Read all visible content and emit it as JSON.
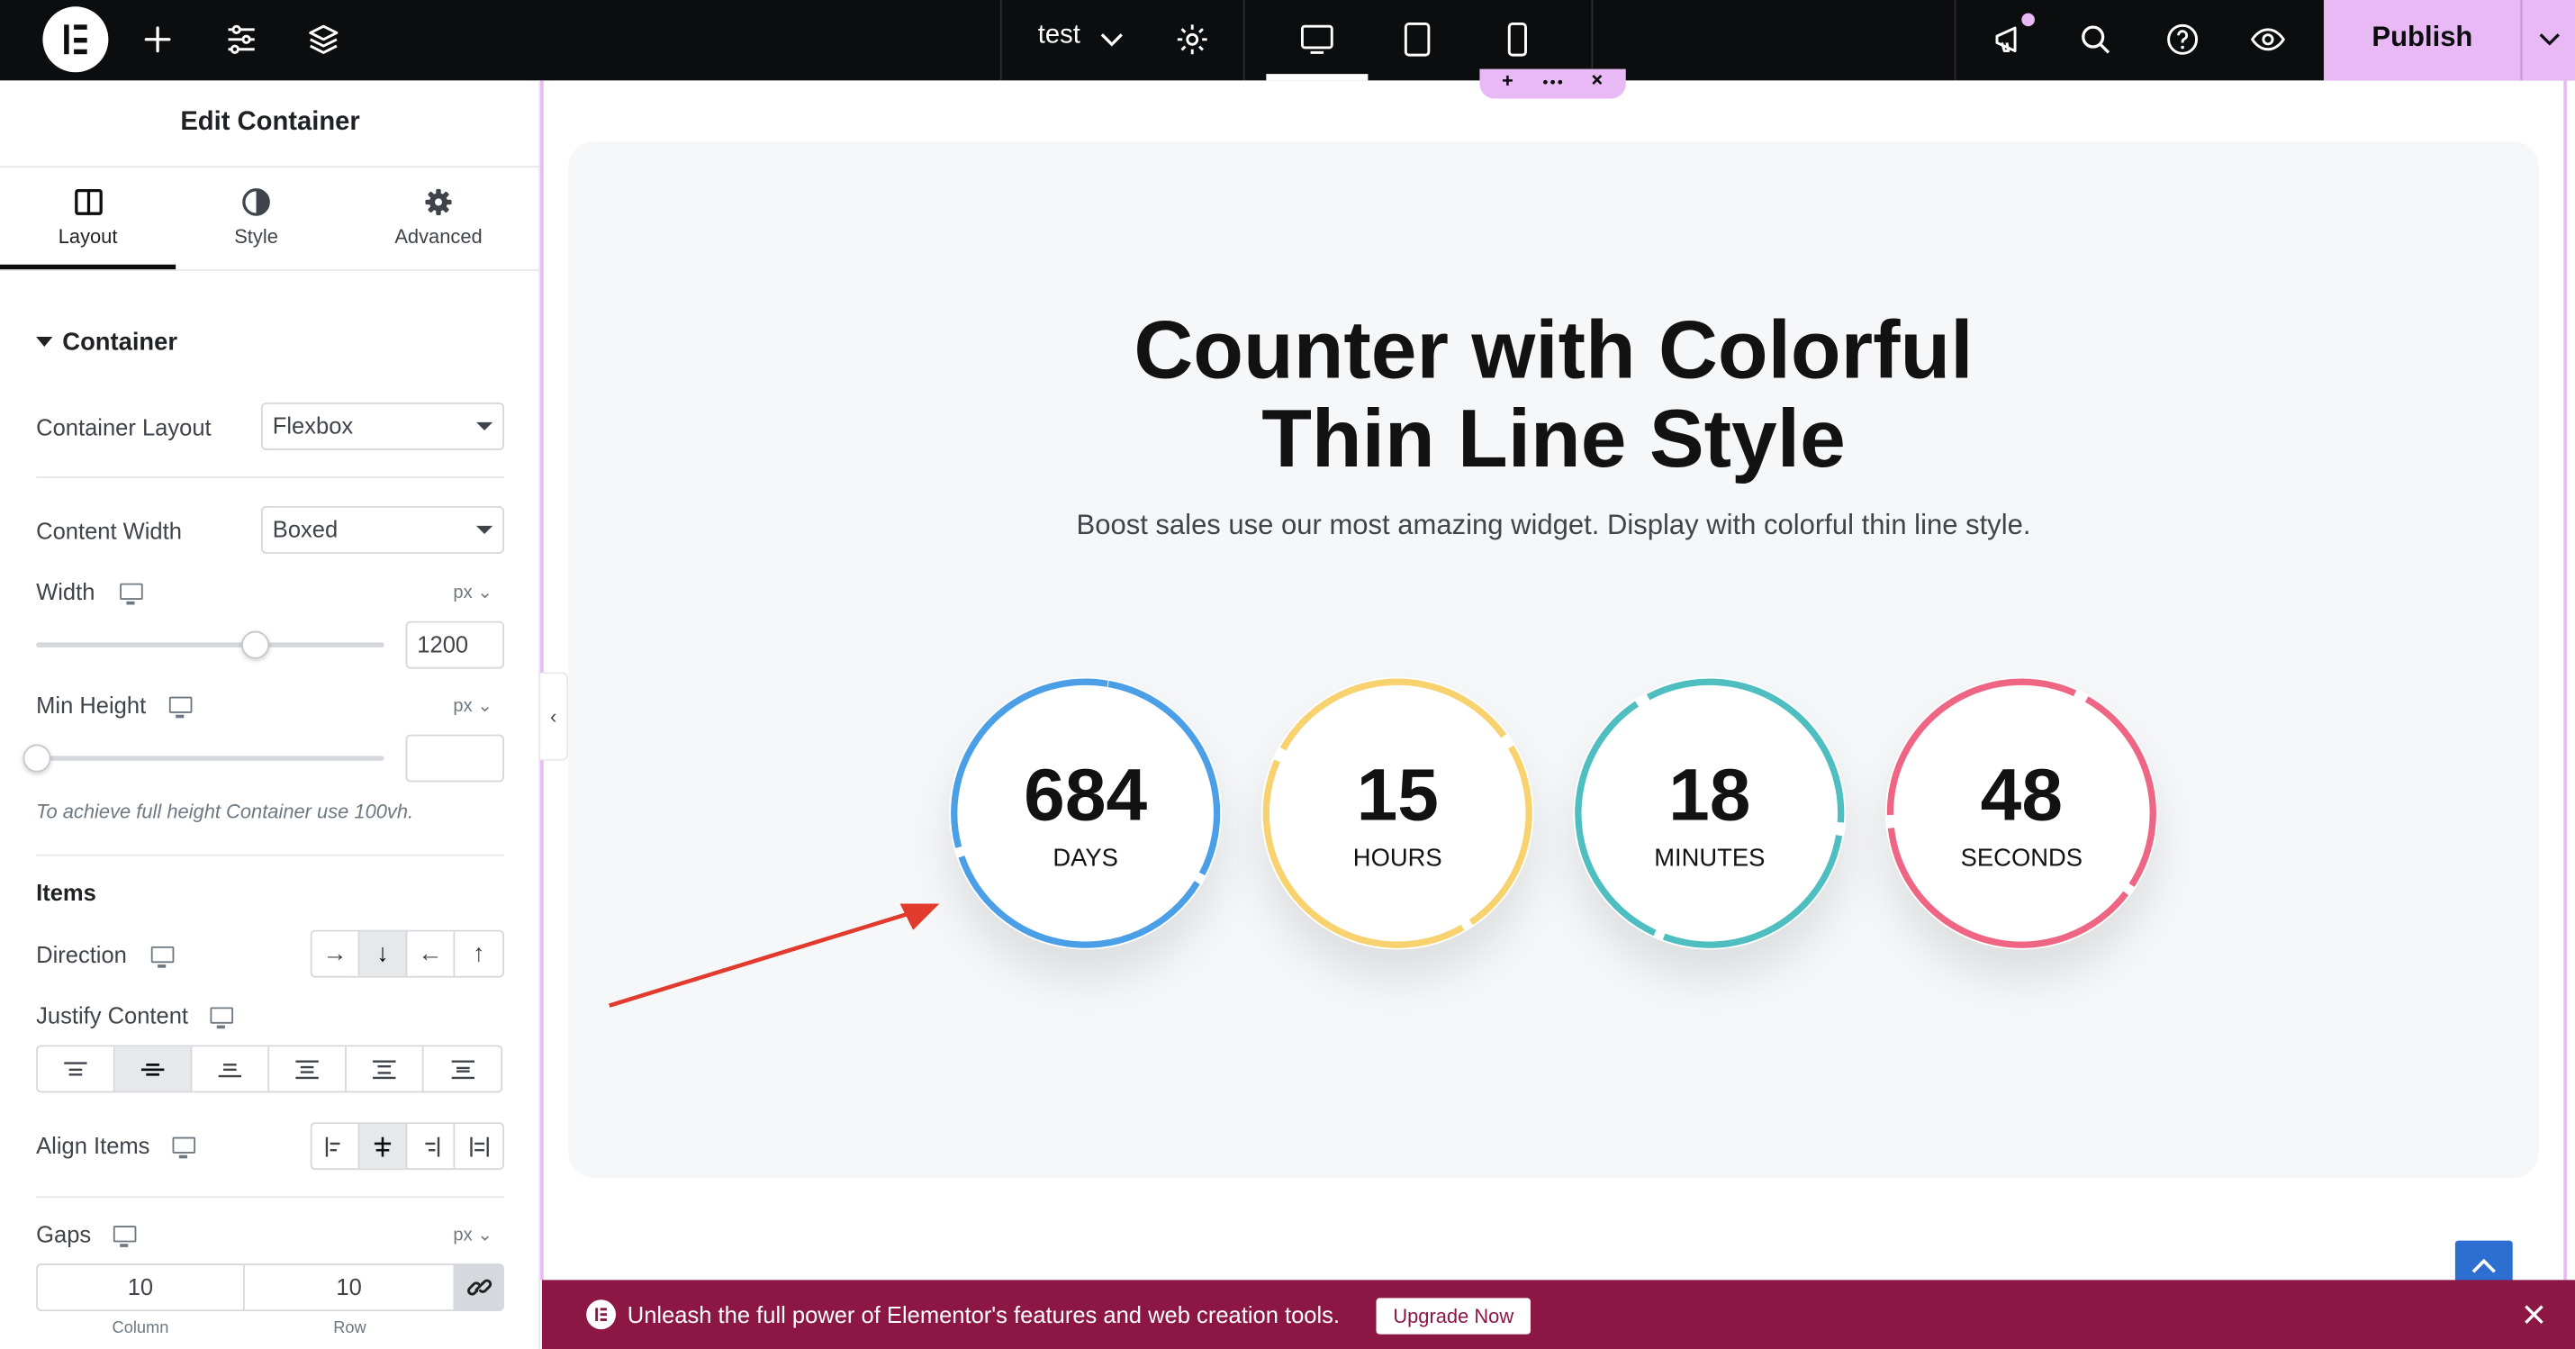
{
  "topbar": {
    "document_title": "test",
    "publish_label": "Publish",
    "icons": [
      "elementor-logo-icon",
      "add-icon",
      "settings-sliders-icon",
      "layers-icon",
      "chevron-down-icon",
      "gear-icon",
      "desktop-icon",
      "tablet-icon",
      "mobile-icon",
      "announcements-icon",
      "search-icon",
      "help-icon",
      "preview-eye-icon"
    ],
    "accent_color": "#e8b9f4"
  },
  "panel": {
    "title": "Edit Container",
    "tabs": [
      {
        "label": "Layout",
        "icon": "layout-icon",
        "active": true
      },
      {
        "label": "Style",
        "icon": "style-half-circle-icon",
        "active": false
      },
      {
        "label": "Advanced",
        "icon": "gear-icon",
        "active": false
      }
    ],
    "section_title": "Container",
    "container_layout": {
      "label": "Container Layout",
      "value": "Flexbox"
    },
    "content_width": {
      "label": "Content Width",
      "value": "Boxed"
    },
    "width": {
      "label": "Width",
      "unit": "px",
      "value": "1200",
      "slider_fraction": 0.63
    },
    "min_height": {
      "label": "Min Height",
      "unit": "px",
      "value": "",
      "slider_fraction": 0.0
    },
    "min_height_hint": "To achieve full height Container use 100vh.",
    "items_title": "Items",
    "direction": {
      "label": "Direction",
      "options": [
        "→",
        "↓",
        "←",
        "↑"
      ],
      "selected_index": 1
    },
    "justify_content": {
      "label": "Justify Content",
      "selected_index": 1
    },
    "align_items": {
      "label": "Align Items",
      "selected_index": 1
    },
    "gaps": {
      "label": "Gaps",
      "unit": "px",
      "column": "10",
      "row": "10",
      "column_label": "Column",
      "row_label": "Row"
    }
  },
  "canvas": {
    "headline_line1": "Counter with Colorful",
    "headline_line2": "Thin Line Style",
    "subline": "Boost sales use our most amazing widget. Display with colorful thin line style.",
    "counters": [
      {
        "value": "684",
        "label": "DAYS",
        "color": "#4b9fe6"
      },
      {
        "value": "15",
        "label": "HOURS",
        "color": "#f7d26e"
      },
      {
        "value": "18",
        "label": "MINUTES",
        "color": "#4fbec1"
      },
      {
        "value": "48",
        "label": "SECONDS",
        "color": "#ee6684"
      }
    ],
    "annotation_arrow_color": "#e23a2c"
  },
  "banner": {
    "text": "Unleash the full power of Elementor's features and web creation tools.",
    "button_label": "Upgrade Now",
    "background": "#8c1644"
  }
}
